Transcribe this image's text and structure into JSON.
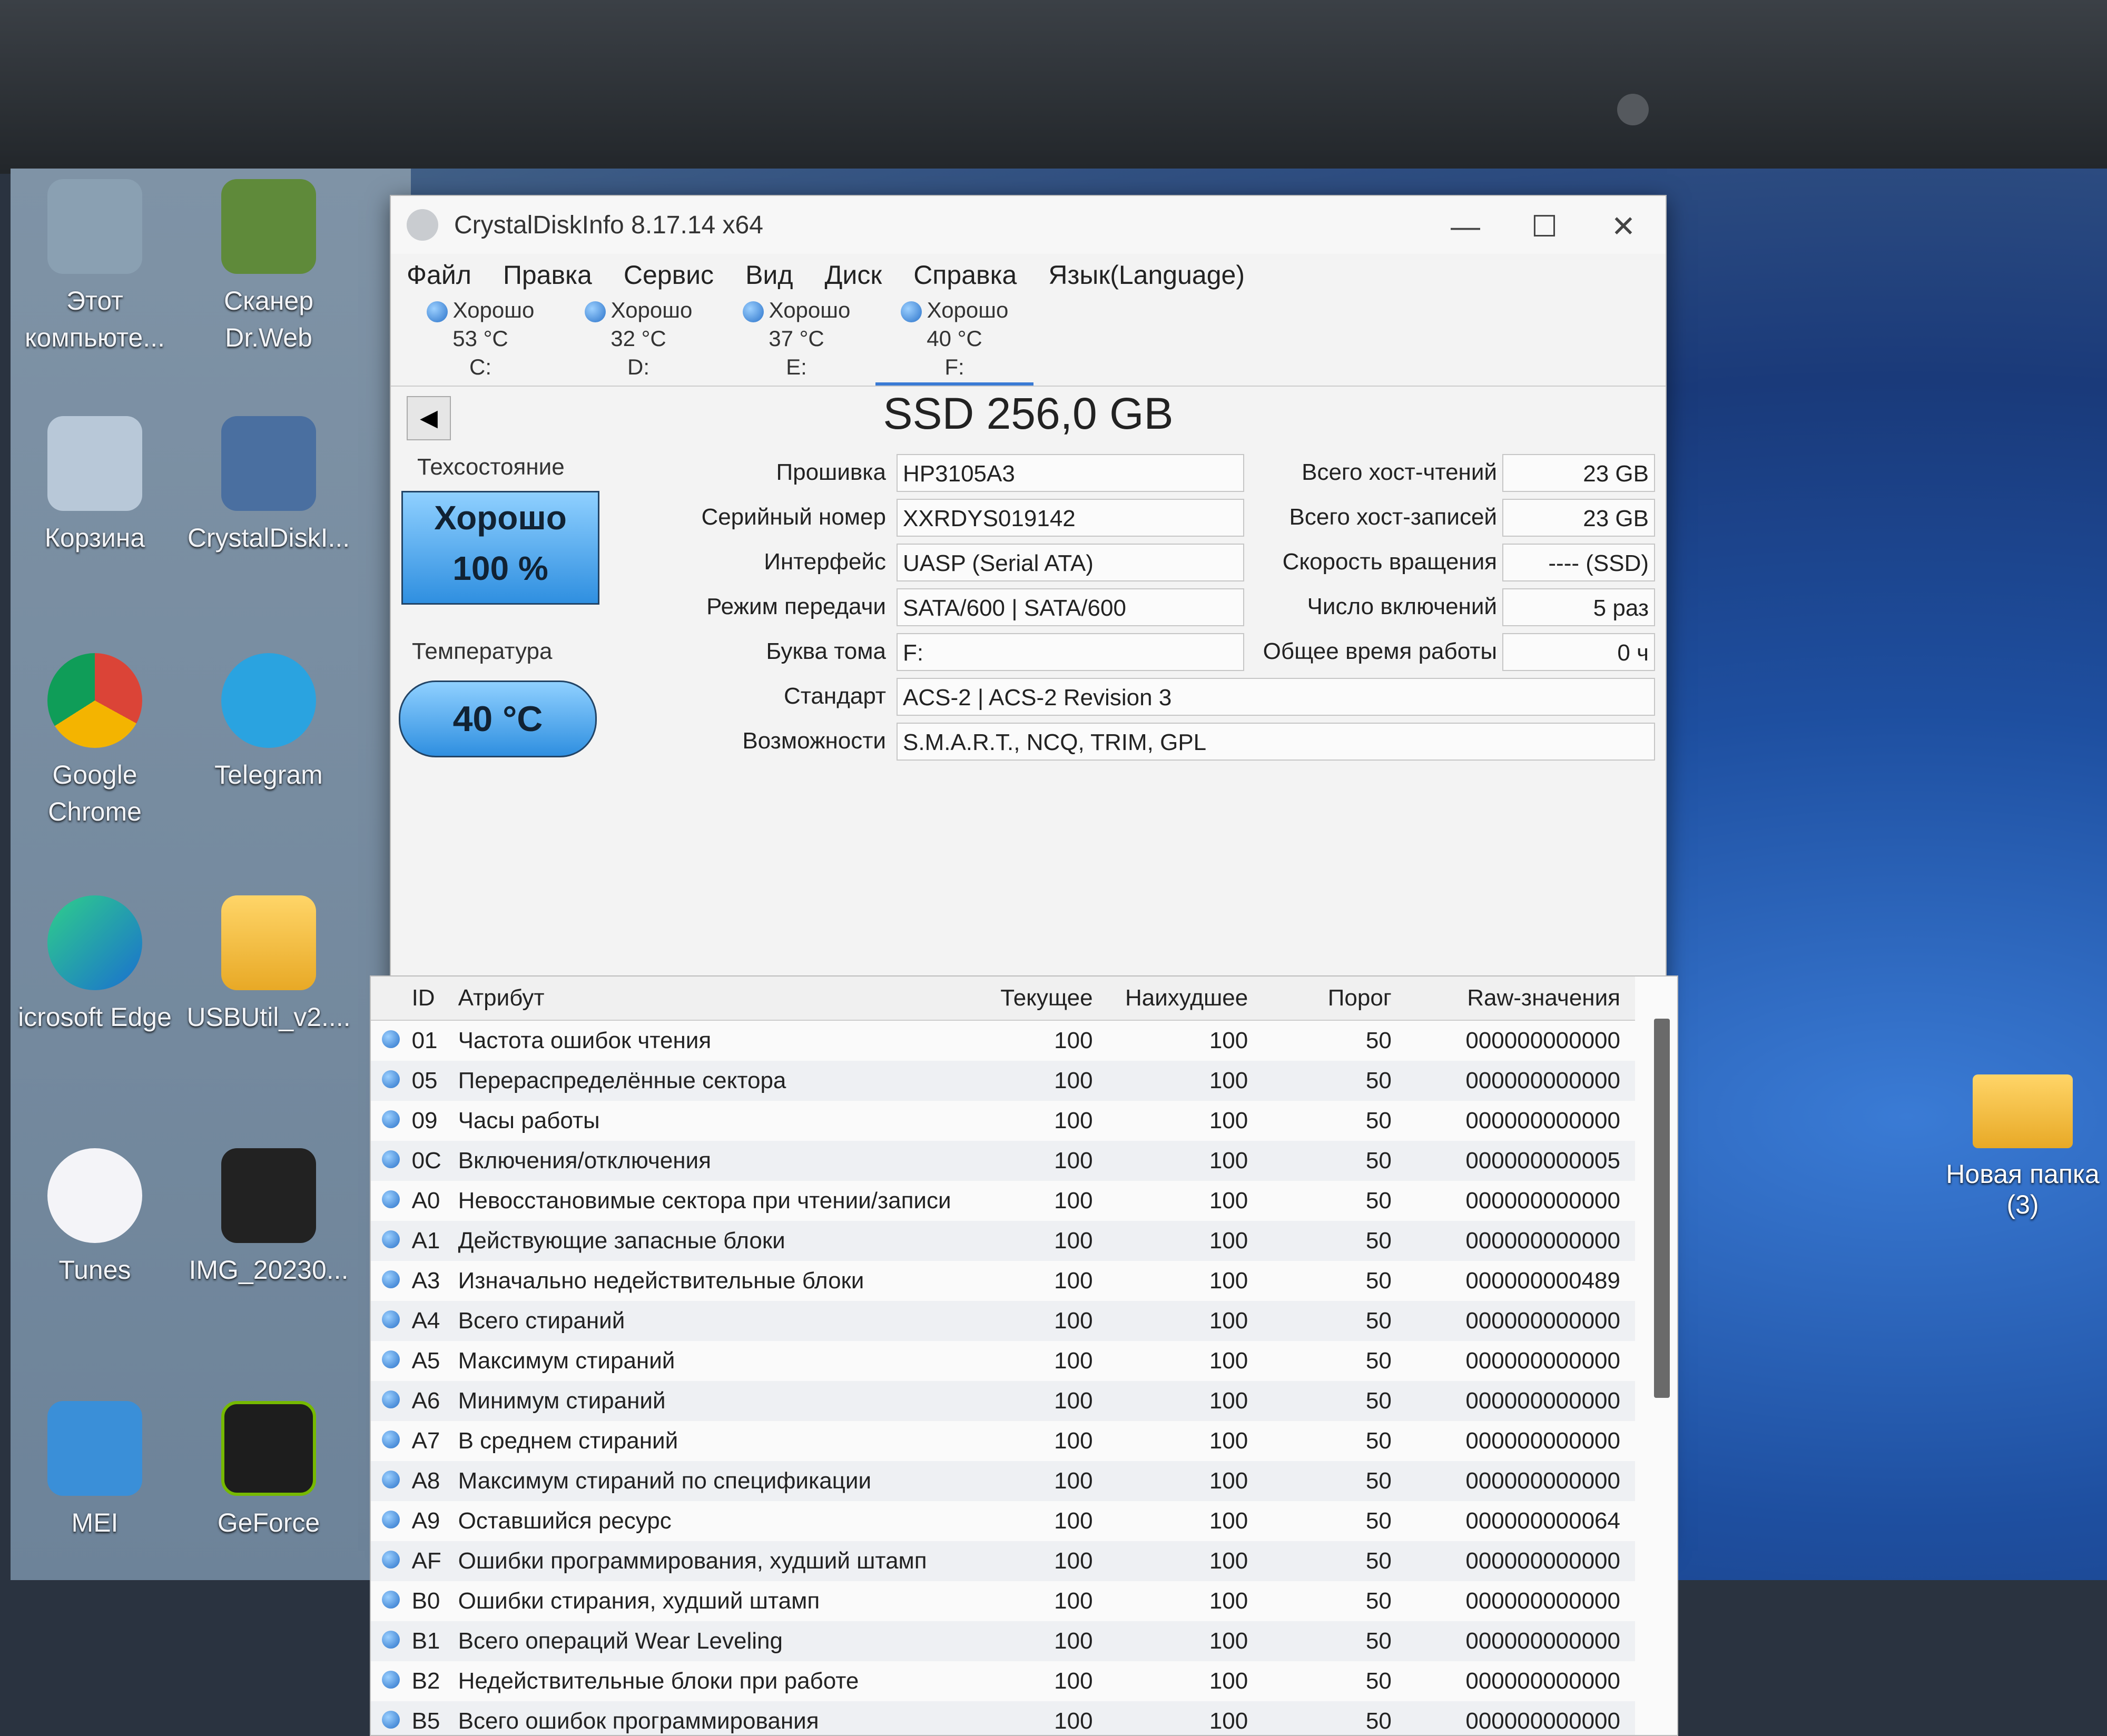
{
  "desktop": {
    "icons_left": [
      {
        "label": "Этот компьюте...",
        "glyph": "monitor-icon"
      },
      {
        "label": "Сканер Dr.Web",
        "glyph": "drweb-icon"
      },
      {
        "label": "Корзина",
        "glyph": "recycle-bin-icon"
      },
      {
        "label": "CrystalDiskI...",
        "glyph": "crystaldisk-icon"
      },
      {
        "label": "Google Chrome",
        "glyph": "chrome-icon"
      },
      {
        "label": "Telegram",
        "glyph": "telegram-icon"
      },
      {
        "label": "icrosoft Edge",
        "glyph": "edge-icon"
      },
      {
        "label": "USBUtil_v2....",
        "glyph": "folder-icon"
      },
      {
        "label": "Tunes",
        "glyph": "itunes-icon"
      },
      {
        "label": "IMG_20230...",
        "glyph": "image-icon"
      },
      {
        "label": "MEI",
        "glyph": "app-icon"
      },
      {
        "label": "GeForce",
        "glyph": "geforce-icon"
      }
    ],
    "folder_right": {
      "label": "Новая папка (3)"
    }
  },
  "window": {
    "title": "CrystalDiskInfo 8.17.14 x64",
    "controls": {
      "minimize": "—",
      "maximize": "☐",
      "close": "✕"
    },
    "menu": [
      "Файл",
      "Правка",
      "Сервис",
      "Вид",
      "Диск",
      "Справка",
      "Язык(Language)"
    ],
    "drives": [
      {
        "status": "Хорошо",
        "temp": "53 °C",
        "letter": "C:"
      },
      {
        "status": "Хорошо",
        "temp": "32 °C",
        "letter": "D:"
      },
      {
        "status": "Хорошо",
        "temp": "37 °C",
        "letter": "E:"
      },
      {
        "status": "Хорошо",
        "temp": "40 °C",
        "letter": "F:"
      }
    ],
    "back_button": "◀",
    "disk_title": "SSD 256,0 GB",
    "health_label": "Техсостояние",
    "health_status": "Хорошо",
    "health_percent": "100 %",
    "temp_label": "Температура",
    "temp_value": "40 °C",
    "fields": {
      "firmware": {
        "label": "Прошивка",
        "value": "HP3105A3"
      },
      "serial": {
        "label": "Серийный номер",
        "value": "XXRDYS019142"
      },
      "interface": {
        "label": "Интерфейс",
        "value": "UASP (Serial ATA)"
      },
      "transfer": {
        "label": "Режим передачи",
        "value": "SATA/600 | SATA/600"
      },
      "volume": {
        "label": "Буква тома",
        "value": "F:"
      },
      "standard": {
        "label": "Стандарт",
        "value": "ACS-2 | ACS-2 Revision 3"
      },
      "features": {
        "label": "Возможности",
        "value": "S.M.A.R.T., NCQ, TRIM, GPL"
      },
      "host_reads": {
        "label": "Всего хост-чтений",
        "value": "23 GB"
      },
      "host_writes": {
        "label": "Всего хост-записей",
        "value": "23 GB"
      },
      "rotation": {
        "label": "Скорость вращения",
        "value": "---- (SSD)"
      },
      "power_count": {
        "label": "Число включений",
        "value": "5 раз"
      },
      "power_hours": {
        "label": "Общее время работы",
        "value": "0 ч"
      }
    },
    "table": {
      "headers": {
        "id": "ID",
        "attr": "Атрибут",
        "cur": "Текущее",
        "worst": "Наихудшее",
        "thr": "Порог",
        "raw": "Raw-значения"
      },
      "rows": [
        {
          "id": "01",
          "attr": "Частота ошибок чтения",
          "cur": "100",
          "worst": "100",
          "thr": "50",
          "raw": "000000000000"
        },
        {
          "id": "05",
          "attr": "Перераспределённые сектора",
          "cur": "100",
          "worst": "100",
          "thr": "50",
          "raw": "000000000000"
        },
        {
          "id": "09",
          "attr": "Часы работы",
          "cur": "100",
          "worst": "100",
          "thr": "50",
          "raw": "000000000000"
        },
        {
          "id": "0C",
          "attr": "Включения/отключения",
          "cur": "100",
          "worst": "100",
          "thr": "50",
          "raw": "000000000005"
        },
        {
          "id": "A0",
          "attr": "Невосстановимые сектора при чтении/записи",
          "cur": "100",
          "worst": "100",
          "thr": "50",
          "raw": "000000000000"
        },
        {
          "id": "A1",
          "attr": "Действующие запасные блоки",
          "cur": "100",
          "worst": "100",
          "thr": "50",
          "raw": "000000000000"
        },
        {
          "id": "A3",
          "attr": "Изначально недействительные блоки",
          "cur": "100",
          "worst": "100",
          "thr": "50",
          "raw": "000000000489"
        },
        {
          "id": "A4",
          "attr": "Всего стираний",
          "cur": "100",
          "worst": "100",
          "thr": "50",
          "raw": "000000000000"
        },
        {
          "id": "A5",
          "attr": "Максимум стираний",
          "cur": "100",
          "worst": "100",
          "thr": "50",
          "raw": "000000000000"
        },
        {
          "id": "A6",
          "attr": "Минимум стираний",
          "cur": "100",
          "worst": "100",
          "thr": "50",
          "raw": "000000000000"
        },
        {
          "id": "A7",
          "attr": "В среднем стираний",
          "cur": "100",
          "worst": "100",
          "thr": "50",
          "raw": "000000000000"
        },
        {
          "id": "A8",
          "attr": "Максимум стираний по спецификации",
          "cur": "100",
          "worst": "100",
          "thr": "50",
          "raw": "000000000000"
        },
        {
          "id": "A9",
          "attr": "Оставшийся ресурс",
          "cur": "100",
          "worst": "100",
          "thr": "50",
          "raw": "000000000064"
        },
        {
          "id": "AF",
          "attr": "Ошибки программирования, худший штамп",
          "cur": "100",
          "worst": "100",
          "thr": "50",
          "raw": "000000000000"
        },
        {
          "id": "B0",
          "attr": "Ошибки стирания, худший штамп",
          "cur": "100",
          "worst": "100",
          "thr": "50",
          "raw": "000000000000"
        },
        {
          "id": "B1",
          "attr": "Всего операций Wear Leveling",
          "cur": "100",
          "worst": "100",
          "thr": "50",
          "raw": "000000000000"
        },
        {
          "id": "B2",
          "attr": "Недействительные блоки при работе",
          "cur": "100",
          "worst": "100",
          "thr": "50",
          "raw": "000000000000"
        },
        {
          "id": "B5",
          "attr": "Всего ошибок программирования",
          "cur": "100",
          "worst": "100",
          "thr": "50",
          "raw": "000000000000"
        }
      ]
    }
  }
}
